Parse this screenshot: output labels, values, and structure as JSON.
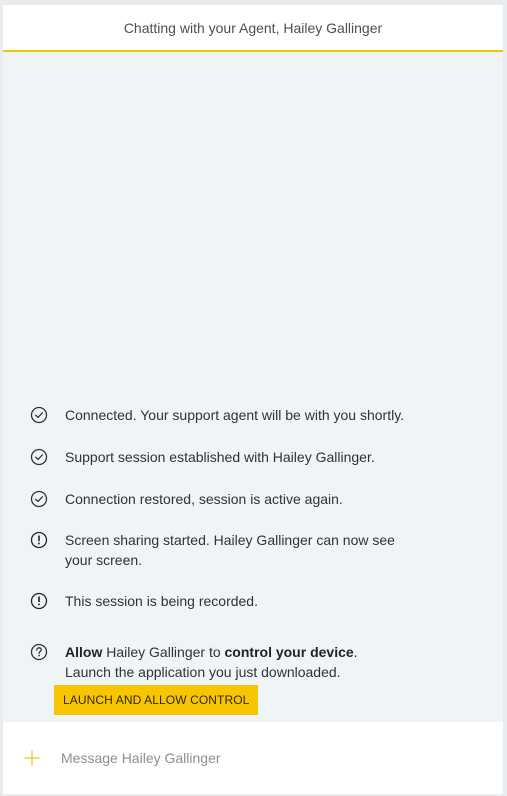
{
  "header": {
    "title": "Chatting with your Agent, Hailey Gallinger"
  },
  "colors": {
    "accent": "#f4c400",
    "button": "#f7c600",
    "chat_background": "#eff4f7"
  },
  "messages": [
    {
      "icon": "check-circle-icon",
      "text": "Connected. Your support agent will be with you shortly."
    },
    {
      "icon": "check-circle-icon",
      "text": "Support session established with Hailey Gallinger."
    },
    {
      "icon": "check-circle-icon",
      "text": "Connection restored, session is active again."
    },
    {
      "icon": "exclamation-circle-icon",
      "text": "Screen sharing started. Hailey Gallinger can now see your screen."
    },
    {
      "icon": "exclamation-circle-icon",
      "text": "This session is being recorded."
    }
  ],
  "prompt": {
    "icon": "question-circle-icon",
    "allow": "Allow",
    "agent": " Hailey Gallinger to ",
    "control": "control your device",
    "period": ".",
    "instruction": "Launch the application you just downloaded.",
    "button_label": "LAUNCH AND ALLOW CONTROL"
  },
  "composer": {
    "add_icon": "plus-icon",
    "placeholder": "Message Hailey Gallinger",
    "value": ""
  }
}
